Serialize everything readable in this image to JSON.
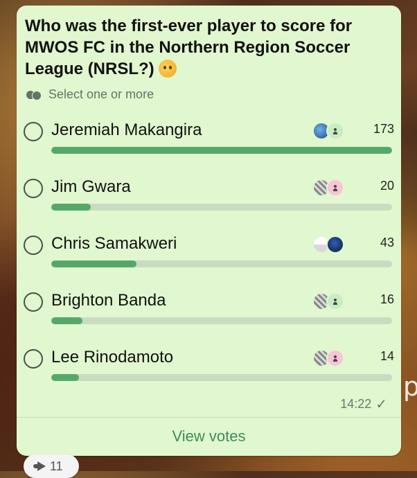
{
  "poll": {
    "question": "Who was the first-ever player to score for MWOS FC in the Northern Region Soccer League (NRSL?)",
    "emoji_icon": "thinking-face-icon",
    "hint": "Select one or more",
    "options": [
      {
        "label": "Jeremiah Makangira",
        "votes": "173",
        "fraction": 1.0
      },
      {
        "label": "Jim Gwara",
        "votes": "20",
        "fraction": 0.116
      },
      {
        "label": "Chris Samakweri",
        "votes": "43",
        "fraction": 0.249
      },
      {
        "label": "Brighton Banda",
        "votes": "16",
        "fraction": 0.092
      },
      {
        "label": "Lee Rinodamoto",
        "votes": "14",
        "fraction": 0.081
      }
    ],
    "time": "14:22",
    "view_votes": "View votes"
  },
  "reaction": {
    "icon": "forward-icon",
    "count": "11"
  },
  "background_text": "p",
  "colors": {
    "bubble": "#e1f7cf",
    "bar_fill": "#56a86a",
    "bar_track": "#c9dcc0",
    "accent": "#3f8a5b"
  }
}
